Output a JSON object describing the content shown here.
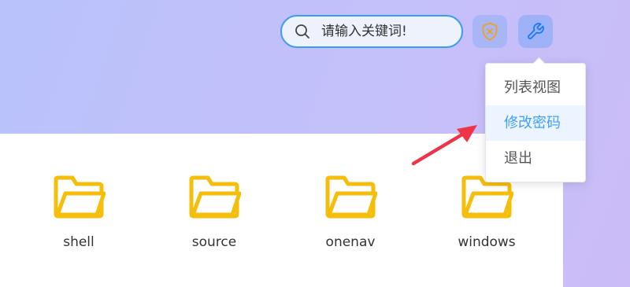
{
  "search": {
    "placeholder": "请输入关键词!"
  },
  "header": {
    "shield_icon": "shield-x-icon",
    "wrench_icon": "wrench-icon",
    "colors": {
      "accent": "#409eff",
      "shield": "#f0a020",
      "folder": "#f5be0b",
      "arrow": "#ef3349"
    }
  },
  "menu": {
    "items": [
      {
        "label": "列表视图"
      },
      {
        "label": "修改密码",
        "active": true
      },
      {
        "label": "退出"
      }
    ]
  },
  "folders": [
    {
      "name": "shell"
    },
    {
      "name": "source"
    },
    {
      "name": "onenav"
    },
    {
      "name": "windows"
    }
  ]
}
